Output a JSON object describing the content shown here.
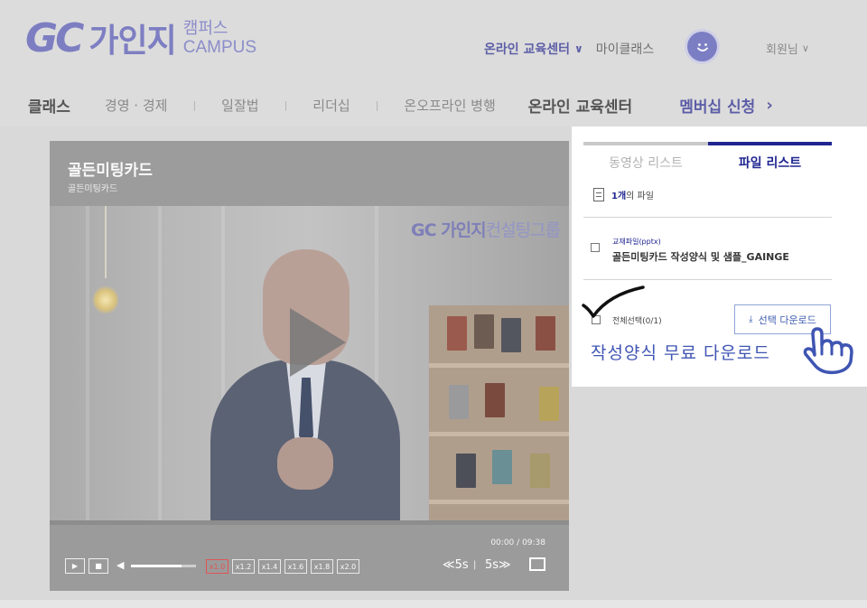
{
  "header": {
    "logo_mark": "GC",
    "logo_name": "가인지",
    "logo_sub_kr": "캠퍼스",
    "logo_sub_en": "CAMPUS",
    "edu_center": "온라인 교육센터",
    "my_class": "마이클래스",
    "member": "회원님"
  },
  "main_nav": {
    "classes": "클래스",
    "items": [
      "경영 · 경제",
      "일잘법",
      "리더십",
      "온오프라인 병행"
    ],
    "separator": "|",
    "online_center": "온라인 교육센터",
    "membership": "멤버십 신청"
  },
  "player": {
    "title": "골든미팅카드",
    "subtitle": "골든미팅카드",
    "watermark_mark": "GC 가인지",
    "watermark_sub": "컨설팅그룹",
    "time_current": "00:00",
    "time_sep": "/",
    "time_total": "09:38",
    "volume_level": 0.78,
    "speeds": [
      "x1.0",
      "x1.2",
      "x1.4",
      "x1.6",
      "x1.8",
      "x2.0"
    ],
    "active_speed": "x1.0",
    "skip_back": "≪5s",
    "skip_sep": "|",
    "skip_fwd": "5s≫"
  },
  "panel": {
    "tab_video": "동영상 리스트",
    "tab_file": "파일 리스트",
    "file_count_num": "1개",
    "file_count_suffix": "의 파일",
    "file_type": "교재파일(pptx)",
    "file_name": "골든미팅카드 작성양식 및 샘플_GAINGE",
    "select_all": "전체선택(0/1)",
    "download_button": "선택 다운로드"
  },
  "annotation": {
    "text": "작성양식 무료 다운로드"
  },
  "colors": {
    "brand": "#7d7ec2",
    "accent_navy": "#1f2590",
    "annotation_blue": "#3f55b3"
  }
}
